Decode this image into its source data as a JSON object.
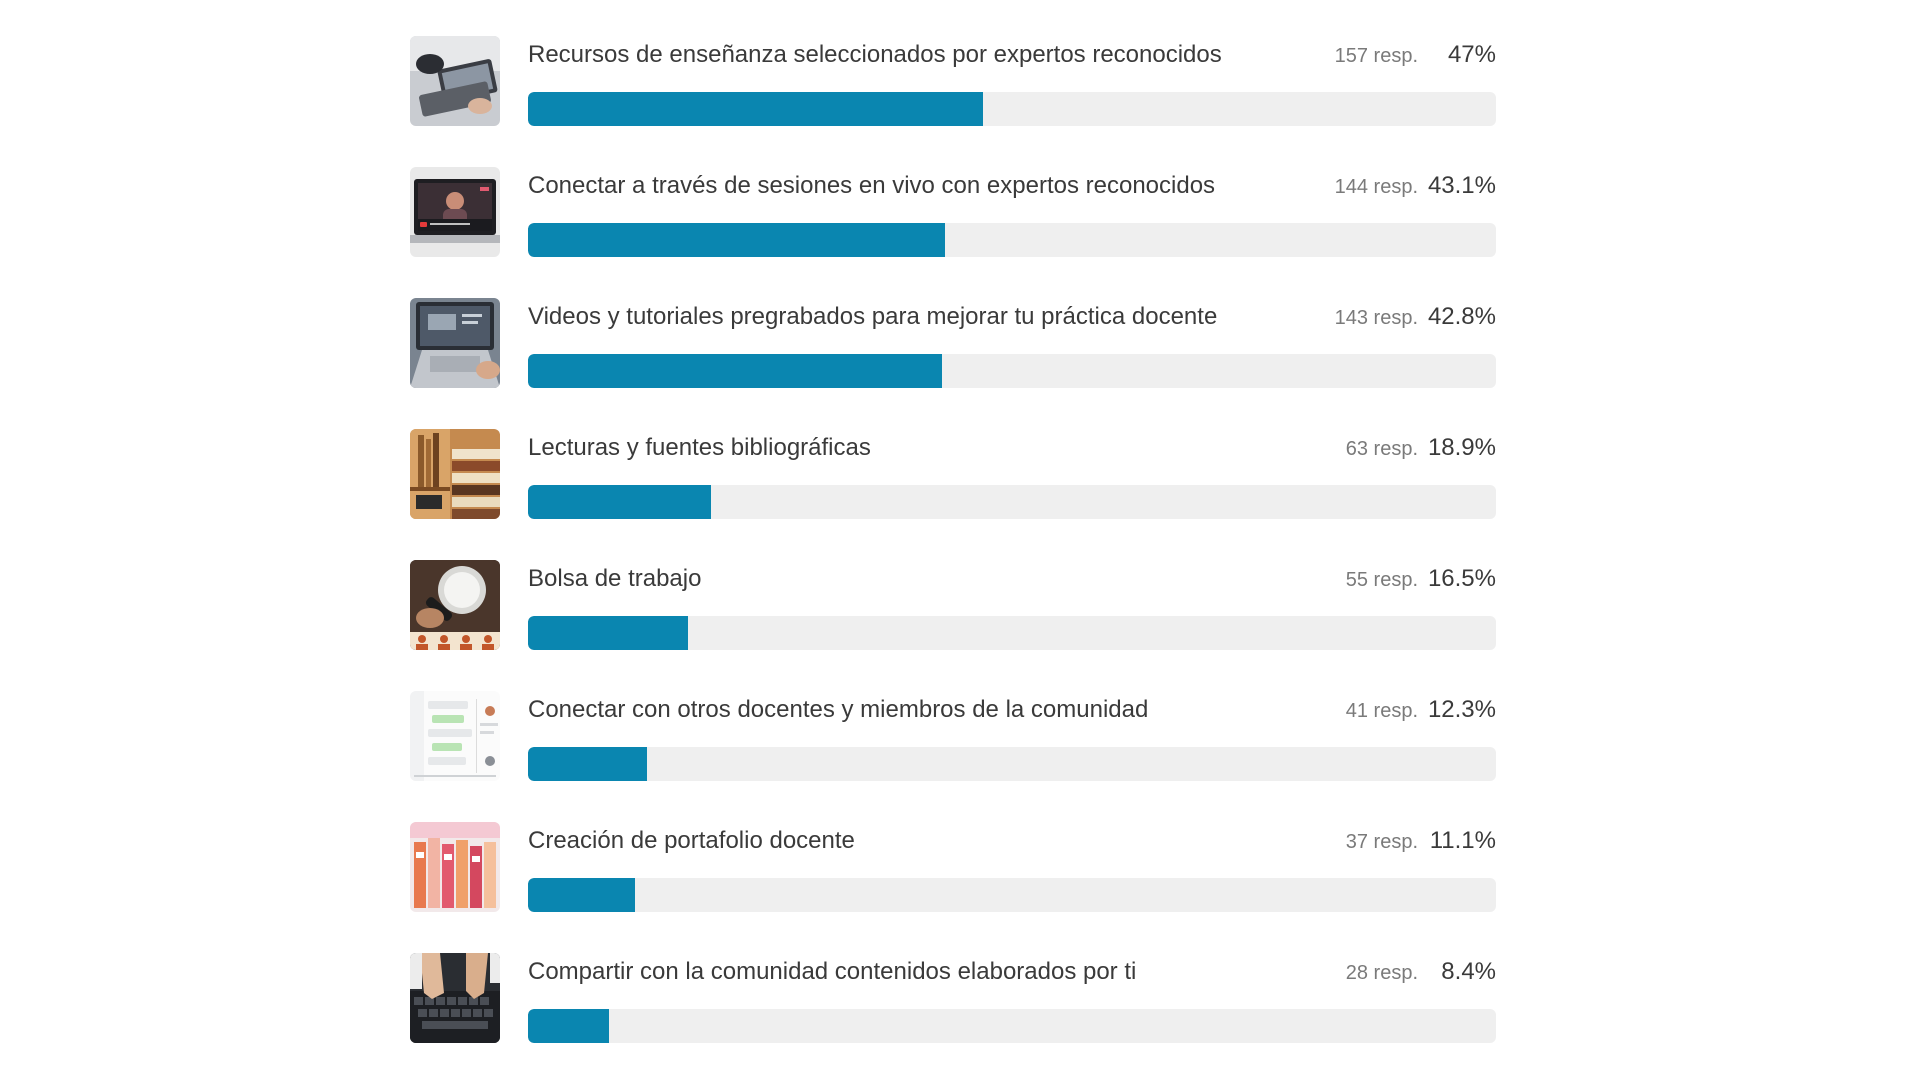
{
  "colors": {
    "bar_fill": "#0a86b0",
    "bar_track": "#efefef"
  },
  "chart_data": {
    "type": "bar",
    "orientation": "horizontal",
    "categories": [
      "Recursos de enseñanza seleccionados por expertos reconocidos",
      "Conectar a través de sesiones en vivo con expertos reconocidos",
      "Videos y tutoriales pregrabados para mejorar tu práctica docente",
      "Lecturas y fuentes bibliográficas",
      "Bolsa de trabajo",
      "Conectar con otros docentes y miembros de la comunidad",
      "Creación de portafolio docente",
      "Compartir con la comunidad contenidos elaborados por ti"
    ],
    "values": [
      47,
      43.1,
      42.8,
      18.9,
      16.5,
      12.3,
      11.1,
      8.4
    ],
    "ylim": [
      0,
      100
    ],
    "grid": false
  },
  "options": [
    {
      "label": "Recursos de enseñanza seleccionados por expertos reconocidos",
      "count": "157 resp.",
      "pct": "47%",
      "icon": "teaching-resources-photo-icon"
    },
    {
      "label": "Conectar a través de sesiones en vivo con expertos reconocidos",
      "count": "144 resp.",
      "pct": "43.1%",
      "icon": "live-session-laptop-photo-icon"
    },
    {
      "label": "Videos y tutoriales pregrabados para mejorar tu práctica docente",
      "count": "143 resp.",
      "pct": "42.8%",
      "icon": "video-tutorial-laptop-photo-icon"
    },
    {
      "label": "Lecturas y fuentes bibliográficas",
      "count": "63 resp.",
      "pct": "18.9%",
      "icon": "books-photo-icon"
    },
    {
      "label": "Bolsa de trabajo",
      "count": "55 resp.",
      "pct": "16.5%",
      "icon": "job-search-magnifier-photo-icon"
    },
    {
      "label": "Conectar con otros docentes y miembros de la comunidad",
      "count": "41 resp.",
      "pct": "12.3%",
      "icon": "community-chat-screenshot-icon"
    },
    {
      "label": "Creación de portafolio docente",
      "count": "37 resp.",
      "pct": "11.1%",
      "icon": "portfolio-folders-photo-icon"
    },
    {
      "label": "Compartir con la comunidad contenidos elaborados por ti",
      "count": "28 resp.",
      "pct": "8.4%",
      "icon": "typing-keyboard-photo-icon"
    }
  ]
}
